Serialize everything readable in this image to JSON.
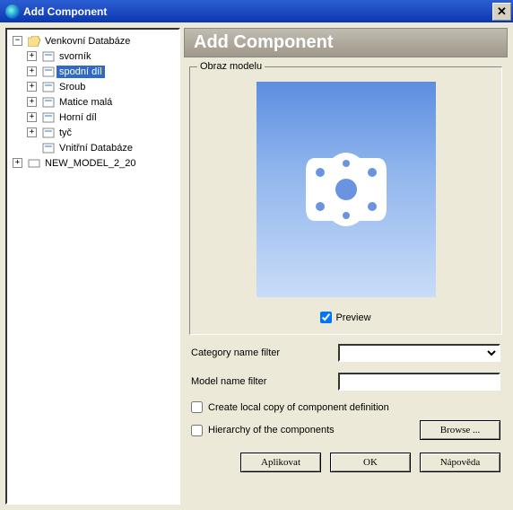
{
  "window": {
    "title": "Add Component"
  },
  "tree": {
    "root1": {
      "label": "Venkovní Databáze",
      "expanded": true,
      "children": [
        {
          "label": "svorník",
          "expand": "+"
        },
        {
          "label": "spodní díl",
          "expand": "+",
          "selected": true
        },
        {
          "label": "Sroub",
          "expand": "+"
        },
        {
          "label": "Matice malá",
          "expand": "+"
        },
        {
          "label": "Horní díl",
          "expand": "+"
        },
        {
          "label": "tyč",
          "expand": "+"
        },
        {
          "label": "Vnitřní Databáze",
          "expand": ""
        }
      ]
    },
    "root2": {
      "label": "NEW_MODEL_2_20",
      "expand": "+"
    }
  },
  "panel": {
    "header": "Add Component",
    "groupbox_label": "Obraz modelu",
    "preview_label": "Preview",
    "category_filter_label": "Category name filter",
    "category_filter_value": "",
    "model_filter_label": "Model name filter",
    "model_filter_value": "",
    "create_local_copy_label": "Create local copy of component definition",
    "hierarchy_label": "Hierarchy of the components",
    "browse_label": "Browse ...",
    "apply_label": "Aplikovat",
    "ok_label": "OK",
    "help_label": "Nápověda"
  }
}
